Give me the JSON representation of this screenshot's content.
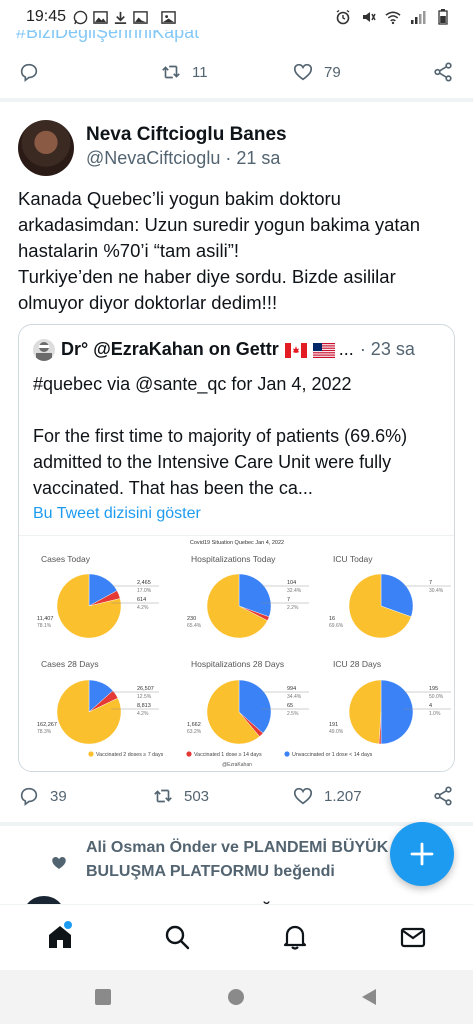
{
  "status_bar": {
    "time": "19:45"
  },
  "prev_tweet": {
    "hashtag": "#BiziDeğilŞehriniKapat",
    "retweets": "11",
    "likes": "79"
  },
  "tweet": {
    "display_name": "Neva Ciftcioglu Banes",
    "handle": "@NevaCiftcioglu",
    "time": "· 21 sa",
    "text": "Kanada Quebec’li yogun bakim doktoru arkadasimdan: Uzun suredir yogun bakima yatan hastalarin %70’i “tam asili”!\nTurkiye’den ne haber diye sordu. Bizde asililar olmuyor diyor doktorlar dedim!!!",
    "replies": "39",
    "retweets": "503",
    "likes": "1.207"
  },
  "quote": {
    "name": "Dr° @EzraKahan on Gettr",
    "ellipsis": "...",
    "time": "· 23 sa",
    "text": "#quebec via @sante_qc for Jan 4, 2022\n\nFor the first time to majority of patients (69.6%) admitted to the Intensive Care Unit were fully vaccinated. That has been the ca...",
    "thread_link": "Bu Tweet dizisini göster"
  },
  "chart_data": {
    "type": "pie",
    "title": "Covid19 Situation Quebec Jan 4, 2022",
    "credit": "@EzraKahan",
    "colors": {
      "vaccinated_2": "#fbc02d",
      "vaccinated_1": "#e53935",
      "unvaccinated": "#3b82f6"
    },
    "legend": [
      {
        "key": "vaccinated_2",
        "label": "Vaccinated 2 doses ≥ 7 days"
      },
      {
        "key": "vaccinated_1",
        "label": "Vaccinated 1 dose ≥ 14 days"
      },
      {
        "key": "unvaccinated",
        "label": "Unvaccinated or 1 dose < 14 days"
      }
    ],
    "panels": [
      {
        "title": "Cases Today",
        "values": [
          11407,
          614,
          2465
        ],
        "labels": [
          "11,407",
          "614",
          "2,465"
        ],
        "pcts": [
          "78.1%",
          "4.2%",
          "17.0%"
        ]
      },
      {
        "title": "Hospitalizations Today",
        "values": [
          230,
          7,
          104
        ],
        "labels": [
          "230",
          "7",
          "104"
        ],
        "pcts": [
          "65.4%",
          "2.2%",
          "32.4%"
        ]
      },
      {
        "title": "ICU Today",
        "values": [
          16,
          0,
          7
        ],
        "labels": [
          "16",
          "",
          "7"
        ],
        "pcts": [
          "69.6%",
          "",
          "30.4%"
        ]
      },
      {
        "title": "Cases 28 Days",
        "values": [
          162267,
          8813,
          26507
        ],
        "labels": [
          "162,267",
          "8,813",
          "26,507"
        ],
        "pcts": [
          "78.3%",
          "4.2%",
          "12.5%"
        ]
      },
      {
        "title": "Hospitalizations 28 Days",
        "values": [
          1662,
          65,
          994
        ],
        "labels": [
          "1,662",
          "65",
          "994"
        ],
        "pcts": [
          "63.2%",
          "2.5%",
          "34.4%"
        ]
      },
      {
        "title": "ICU 28 Days",
        "values": [
          191,
          4,
          195
        ],
        "labels": [
          "191",
          "4",
          "195"
        ],
        "pcts": [
          "49.0%",
          "1.0%",
          "50.0%"
        ]
      }
    ]
  },
  "like_notice": {
    "text": "Ali Osman Önder ve PLANDEMİ BÜYÜK BULUŞMA PLATFORMU beğendi"
  },
  "next_tweet": {
    "display_name": "Ayşe Kaya KARADAĞ"
  }
}
